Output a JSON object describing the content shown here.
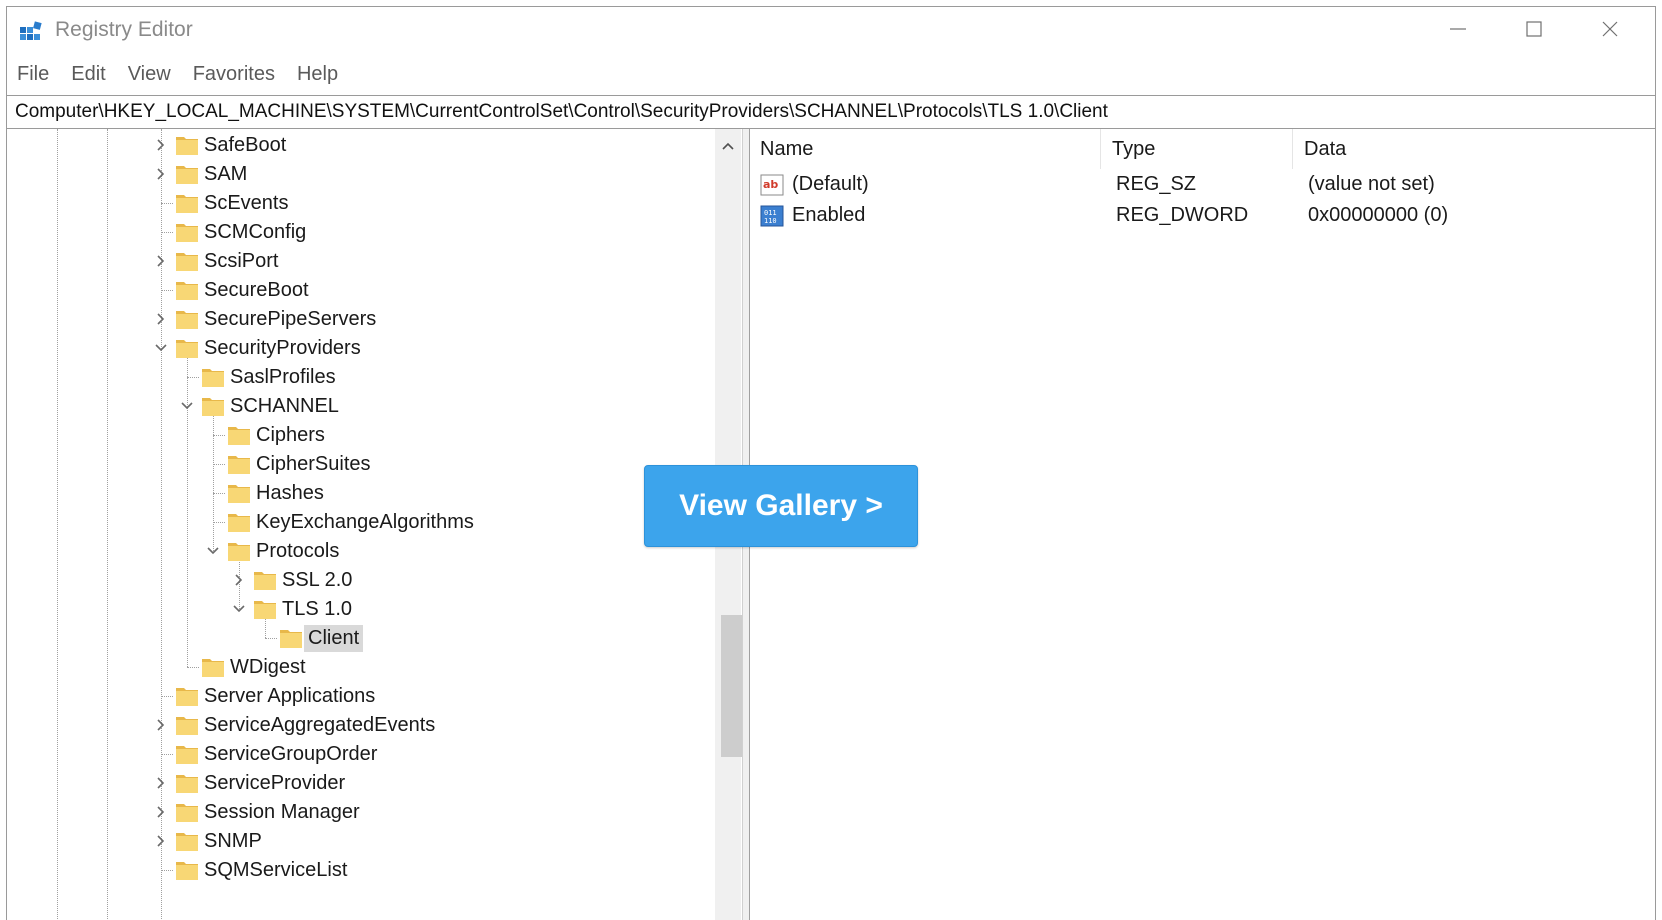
{
  "window": {
    "title": "Registry Editor",
    "menu": [
      "File",
      "Edit",
      "View",
      "Favorites",
      "Help"
    ]
  },
  "address": {
    "value": "Computer\\HKEY_LOCAL_MACHINE\\SYSTEM\\CurrentControlSet\\Control\\SecurityProviders\\SCHANNEL\\Protocols\\TLS 1.0\\Client"
  },
  "tree": {
    "nodes": [
      {
        "label": "SafeBoot",
        "depth": 0,
        "expander": "collapsed"
      },
      {
        "label": "SAM",
        "depth": 0,
        "expander": "collapsed"
      },
      {
        "label": "ScEvents",
        "depth": 0,
        "expander": "none"
      },
      {
        "label": "SCMConfig",
        "depth": 0,
        "expander": "none"
      },
      {
        "label": "ScsiPort",
        "depth": 0,
        "expander": "collapsed"
      },
      {
        "label": "SecureBoot",
        "depth": 0,
        "expander": "none"
      },
      {
        "label": "SecurePipeServers",
        "depth": 0,
        "expander": "collapsed"
      },
      {
        "label": "SecurityProviders",
        "depth": 0,
        "expander": "expanded"
      },
      {
        "label": "SaslProfiles",
        "depth": 1,
        "expander": "none"
      },
      {
        "label": "SCHANNEL",
        "depth": 1,
        "expander": "expanded"
      },
      {
        "label": "Ciphers",
        "depth": 2,
        "expander": "none"
      },
      {
        "label": "CipherSuites",
        "depth": 2,
        "expander": "none"
      },
      {
        "label": "Hashes",
        "depth": 2,
        "expander": "none"
      },
      {
        "label": "KeyExchangeAlgorithms",
        "depth": 2,
        "expander": "none"
      },
      {
        "label": "Protocols",
        "depth": 2,
        "expander": "expanded"
      },
      {
        "label": "SSL 2.0",
        "depth": 3,
        "expander": "collapsed"
      },
      {
        "label": "TLS 1.0",
        "depth": 3,
        "expander": "expanded"
      },
      {
        "label": "Client",
        "depth": 4,
        "expander": "none",
        "selected": true
      },
      {
        "label": "WDigest",
        "depth": 1,
        "expander": "none"
      },
      {
        "label": "Server Applications",
        "depth": 0,
        "expander": "none"
      },
      {
        "label": "ServiceAggregatedEvents",
        "depth": 0,
        "expander": "collapsed"
      },
      {
        "label": "ServiceGroupOrder",
        "depth": 0,
        "expander": "none"
      },
      {
        "label": "ServiceProvider",
        "depth": 0,
        "expander": "collapsed"
      },
      {
        "label": "Session Manager",
        "depth": 0,
        "expander": "collapsed"
      },
      {
        "label": "SNMP",
        "depth": 0,
        "expander": "collapsed"
      },
      {
        "label": "SQMServiceList",
        "depth": 0,
        "expander": "none"
      }
    ]
  },
  "list": {
    "columns": [
      "Name",
      "Type",
      "Data"
    ],
    "rows": [
      {
        "icon": "string-value-icon",
        "name": "(Default)",
        "type": "REG_SZ",
        "data": "(value not set)"
      },
      {
        "icon": "dword-value-icon",
        "name": "Enabled",
        "type": "REG_DWORD",
        "data": "0x00000000 (0)"
      }
    ]
  },
  "overlay": {
    "button_label": "View Gallery >"
  },
  "colors": {
    "overlay_button": "#3ca4ec",
    "folder": "#f8d775",
    "selection": "#d9d9d9"
  }
}
